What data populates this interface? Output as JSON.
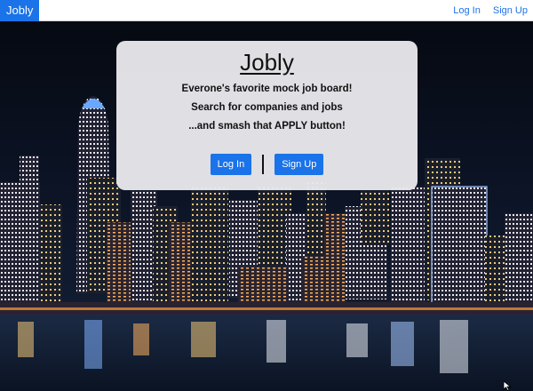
{
  "navbar": {
    "brand": "Jobly",
    "login_label": "Log In",
    "signup_label": "Sign Up"
  },
  "hero": {
    "title": "Jobly",
    "lines": [
      "Everone's favorite mock job board!",
      "Search for companies and jobs",
      "...and smash that APPLY button!"
    ],
    "login_button": "Log In",
    "signup_button": "Sign Up"
  },
  "colors": {
    "accent": "#1a73e8",
    "card_bg": "#e8e8ec",
    "night_sky": "#0a0f1e"
  },
  "background": {
    "type": "city-skyline-at-night"
  }
}
